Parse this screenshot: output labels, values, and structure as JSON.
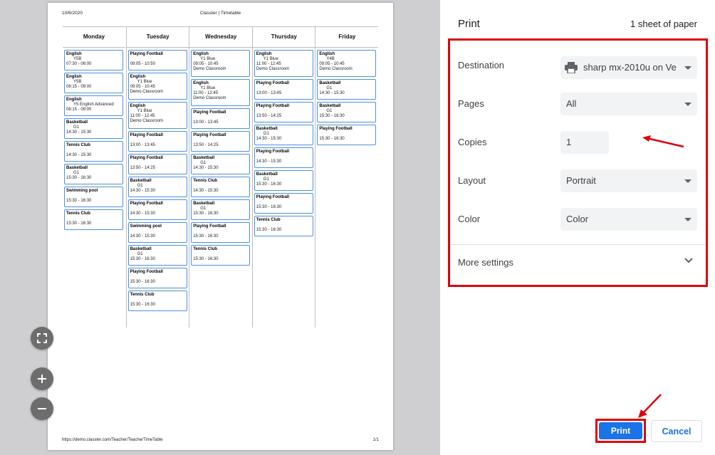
{
  "preview": {
    "header_date": "10/6/2020",
    "header_title": "Classter | Timetable",
    "footer_url": "https://demo.classter.com/Teacher/TeacherTimeTable",
    "footer_page": "1/1",
    "days": [
      {
        "name": "Monday",
        "lessons": [
          {
            "title": "English",
            "group": "Y5B",
            "time": "07:30 - 08:00",
            "room": ""
          },
          {
            "title": "English",
            "group": "Y5B",
            "time": "08:15 - 09:00",
            "room": ""
          },
          {
            "title": "English",
            "group": "Y5 English Advanced",
            "time": "08:15 - 09:00",
            "room": ""
          },
          {
            "title": "Basketball",
            "group": "G1",
            "time": "14:30 - 15:30",
            "room": ""
          },
          {
            "title": "Tennis Club",
            "group": "",
            "time": "14:30 - 15:30",
            "room": ""
          },
          {
            "title": "Basketball",
            "group": "G1",
            "time": "15:30 - 16:30",
            "room": ""
          },
          {
            "title": "Swimming pool",
            "group": "",
            "time": "15:30 - 16:30",
            "room": ""
          },
          {
            "title": "Tennis Club",
            "group": "",
            "time": "15:30 - 16:30",
            "room": ""
          }
        ]
      },
      {
        "name": "Tuesday",
        "lessons": [
          {
            "title": "Playing Football",
            "group": "",
            "time": "09:05 - 10:50",
            "room": ""
          },
          {
            "title": "English",
            "group": "Y1 Blue",
            "time": "09:05 - 10:45",
            "room": "Demo Classroom"
          },
          {
            "title": "English",
            "group": "Y1 Blue",
            "time": "11:00 - 12:45",
            "room": "Demo Classroom"
          },
          {
            "title": "Playing Football",
            "group": "",
            "time": "13:00 - 13:45",
            "room": ""
          },
          {
            "title": "Playing Football",
            "group": "",
            "time": "13:50 - 14:25",
            "room": ""
          },
          {
            "title": "Basketball",
            "group": "G1",
            "time": "14:30 - 15:30",
            "room": ""
          },
          {
            "title": "Playing Football",
            "group": "",
            "time": "14:30 - 15:30",
            "room": ""
          },
          {
            "title": "Swimming pool",
            "group": "",
            "time": "14:30 - 15:30",
            "room": ""
          },
          {
            "title": "Basketball",
            "group": "G1",
            "time": "15:30 - 16:30",
            "room": ""
          },
          {
            "title": "Playing Football",
            "group": "",
            "time": "15:30 - 16:30",
            "room": ""
          },
          {
            "title": "Tennis Club",
            "group": "",
            "time": "15:30 - 16:30",
            "room": ""
          }
        ]
      },
      {
        "name": "Wednesday",
        "lessons": [
          {
            "title": "English",
            "group": "Y1 Blue",
            "time": "09:05 - 10:45",
            "room": "Demo Classroom"
          },
          {
            "title": "English",
            "group": "Y1 Blue",
            "time": "11:00 - 12:45",
            "room": "Demo Classroom"
          },
          {
            "title": "Playing Football",
            "group": "",
            "time": "13:00 - 13:45",
            "room": ""
          },
          {
            "title": "Playing Football",
            "group": "",
            "time": "13:50 - 14:25",
            "room": ""
          },
          {
            "title": "Basketball",
            "group": "G1",
            "time": "14:30 - 15:30",
            "room": ""
          },
          {
            "title": "Tennis Club",
            "group": "",
            "time": "14:30 - 15:30",
            "room": ""
          },
          {
            "title": "Basketball",
            "group": "G1",
            "time": "15:30 - 16:30",
            "room": ""
          },
          {
            "title": "Playing Football",
            "group": "",
            "time": "15:30 - 16:30",
            "room": ""
          },
          {
            "title": "Tennis Club",
            "group": "",
            "time": "15:30 - 16:30",
            "room": ""
          }
        ]
      },
      {
        "name": "Thursday",
        "lessons": [
          {
            "title": "English",
            "group": "Y1 Blue",
            "time": "11:00 - 12:45",
            "room": "Demo Classroom"
          },
          {
            "title": "Playing Football",
            "group": "",
            "time": "13:00 - 13:45",
            "room": ""
          },
          {
            "title": "Playing Football",
            "group": "",
            "time": "13:50 - 14:25",
            "room": ""
          },
          {
            "title": "Basketball",
            "group": "G1",
            "time": "14:30 - 15:30",
            "room": ""
          },
          {
            "title": "Playing Football",
            "group": "",
            "time": "14:30 - 15:30",
            "room": ""
          },
          {
            "title": "Basketball",
            "group": "G1",
            "time": "15:30 - 16:30",
            "room": ""
          },
          {
            "title": "Playing Football",
            "group": "",
            "time": "15:30 - 16:30",
            "room": ""
          },
          {
            "title": "Tennis Club",
            "group": "",
            "time": "15:30 - 16:30",
            "room": ""
          }
        ]
      },
      {
        "name": "Friday",
        "lessons": [
          {
            "title": "English",
            "group": "Y4B",
            "time": "09:05 - 10:45",
            "room": "Demo Classroom"
          },
          {
            "title": "Basketball",
            "group": "G1",
            "time": "14:30 - 15:30",
            "room": ""
          },
          {
            "title": "Basketball",
            "group": "G1",
            "time": "15:30 - 16:30",
            "room": ""
          },
          {
            "title": "Playing Football",
            "group": "",
            "time": "15:30 - 16:30",
            "room": ""
          }
        ]
      }
    ]
  },
  "controls": {
    "fit_icon": "fit-to-page-icon",
    "zoom_in_icon": "zoom-in-icon",
    "zoom_out_icon": "zoom-out-icon"
  },
  "panel": {
    "title": "Print",
    "sheets": "1 sheet of paper",
    "destination": {
      "label": "Destination",
      "value": "sharp mx-2010u on Ve",
      "icon": "printer-icon"
    },
    "pages": {
      "label": "Pages",
      "value": "All"
    },
    "copies": {
      "label": "Copies",
      "value": "1"
    },
    "layout": {
      "label": "Layout",
      "value": "Portrait"
    },
    "color": {
      "label": "Color",
      "value": "Color"
    },
    "more_settings": "More settings",
    "print_button": "Print",
    "cancel_button": "Cancel"
  },
  "colors": {
    "highlight": "#e0000b",
    "accent": "#1a73e8",
    "card_border": "#4f8fe0"
  }
}
